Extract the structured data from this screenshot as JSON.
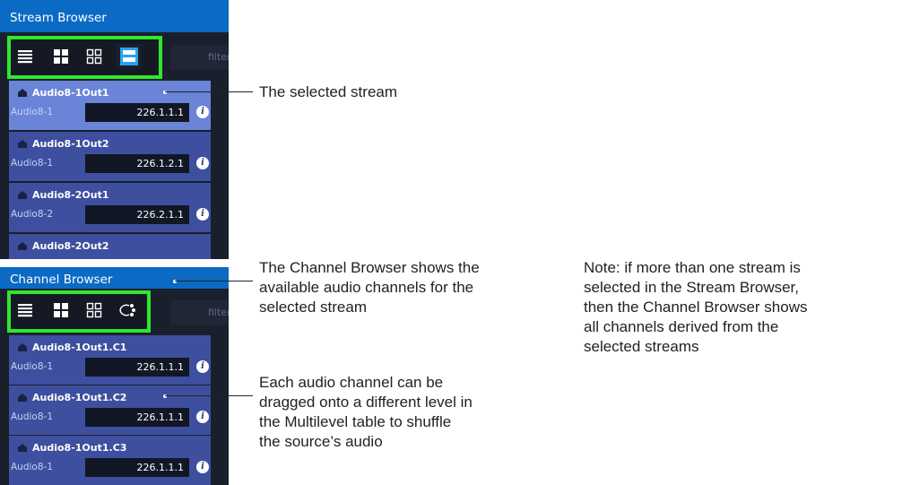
{
  "stream_browser": {
    "title": "Stream Browser",
    "filter_placeholder": "filter",
    "toolbar": [
      "list-view-icon",
      "large-tiles-icon",
      "small-tiles-icon",
      "stream-view-icon"
    ],
    "streams": [
      {
        "name": "Audio8-1Out1",
        "format": "Audio8-1",
        "address": "226.1.1.1",
        "selected": true
      },
      {
        "name": "Audio8-1Out2",
        "format": "Audio8-1",
        "address": "226.1.2.1",
        "selected": false
      },
      {
        "name": "Audio8-2Out1",
        "format": "Audio8-2",
        "address": "226.2.1.1",
        "selected": false
      },
      {
        "name": "Audio8-2Out2",
        "format": "",
        "address": "",
        "selected": false
      }
    ]
  },
  "channel_browser": {
    "title": "Channel Browser",
    "filter_placeholder": "filter",
    "toolbar": [
      "list-view-icon",
      "large-tiles-icon",
      "small-tiles-icon",
      "audio-shuffle-icon"
    ],
    "channels": [
      {
        "name": "Audio8-1Out1.C1",
        "format": "Audio8-1",
        "address": "226.1.1.1"
      },
      {
        "name": "Audio8-1Out1.C2",
        "format": "Audio8-1",
        "address": "226.1.1.1"
      },
      {
        "name": "Audio8-1Out1.C3",
        "format": "Audio8-1",
        "address": "226.1.1.1"
      }
    ]
  },
  "annotations": {
    "selected_stream": "The selected stream",
    "channel_browser_1": "The Channel Browser shows the",
    "channel_browser_2": "available audio channels for the",
    "channel_browser_3": "selected stream",
    "note_1": "Note: if more than one stream is",
    "note_2": "selected in the Stream Browser,",
    "note_3": "then the Channel Browser shows",
    "note_4": "all channels derived from the",
    "note_5": "selected streams",
    "drag_1": "Each audio channel can be",
    "drag_2": "dragged onto a different level in",
    "drag_3": "the Multilevel table to shuffle",
    "drag_4": "the source’s audio"
  },
  "colors": {
    "title_bar": "#0a6ac4",
    "panel_bg": "#1a1f2c",
    "card": "#3d4f9e",
    "card_selected": "#6a84d8",
    "highlight_frame": "#2ee82e",
    "active_view_button": "#2aa3e6"
  }
}
